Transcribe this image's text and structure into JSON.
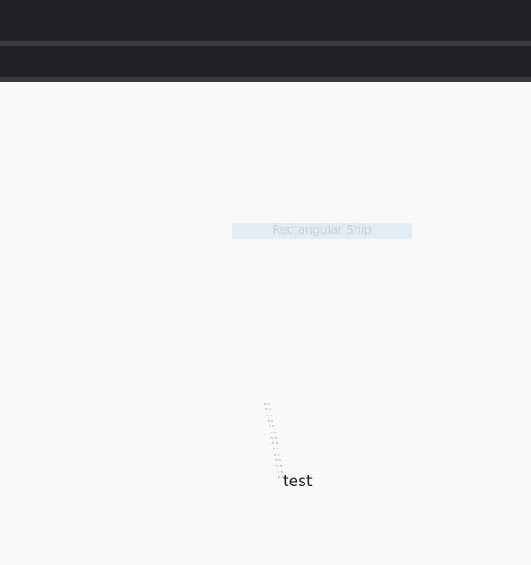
{
  "window": {
    "title": "",
    "toolbar_label": ""
  },
  "snip": {
    "label": "Rectangular Snip"
  },
  "trail": {
    "glyph": "ᵔᵔ",
    "count": 14
  },
  "canvas": {
    "text": "test"
  },
  "colors": {
    "chrome": "#202124",
    "chrome_separator": "#3a3b3f",
    "canvas": "#f9f9f9",
    "snip_background": "#e1ecf4",
    "snip_text": "#c7d2db"
  }
}
